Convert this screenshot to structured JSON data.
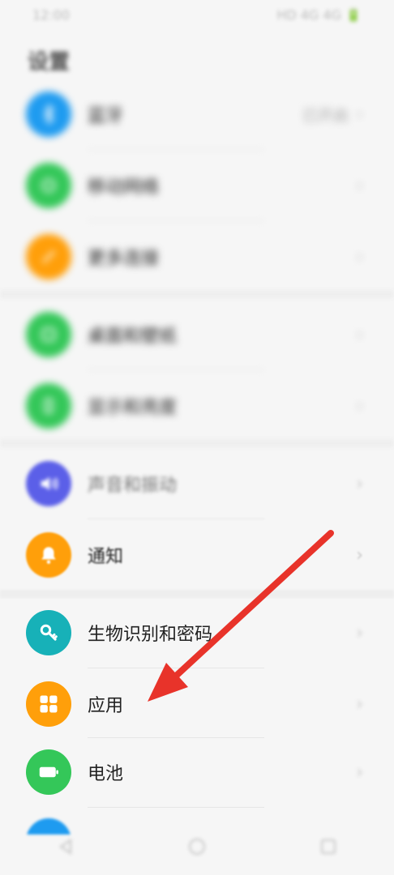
{
  "status": {
    "time": "12:00",
    "right": "HD 4G 4G 🔋"
  },
  "title": "设置",
  "items": [
    {
      "label": "蓝牙",
      "value": "已开启",
      "color": "#1e9bf0"
    },
    {
      "label": "移动网络",
      "value": "",
      "color": "#34c759"
    },
    {
      "label": "更多连接",
      "value": "",
      "color": "#ff9f0a"
    },
    {
      "label": "桌面和壁纸",
      "value": "",
      "color": "#34c759"
    },
    {
      "label": "显示和亮度",
      "value": "",
      "color": "#34c759"
    },
    {
      "label": "声音和振动",
      "value": "",
      "color": "#5b5fe8"
    },
    {
      "label": "通知",
      "value": "",
      "color": "#ff9f0a"
    },
    {
      "label": "生物识别和密码",
      "value": "",
      "color": "#17b1b8"
    },
    {
      "label": "应用",
      "value": "",
      "color": "#ff9f0a"
    },
    {
      "label": "电池",
      "value": "",
      "color": "#34c759"
    }
  ],
  "chevron": "›",
  "arrow_color": "#e8332a"
}
